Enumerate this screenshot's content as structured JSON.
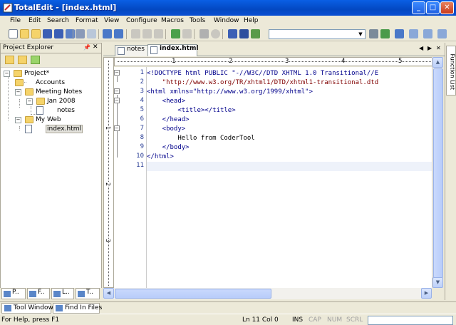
{
  "window": {
    "title": "TotalEdit - [index.html]"
  },
  "menu": [
    "File",
    "Edit",
    "Search",
    "Format",
    "View",
    "Configure",
    "Macros",
    "Tools",
    "Window",
    "Help"
  ],
  "explorer": {
    "title": "Project Explorer",
    "tree": {
      "project": "Project*",
      "accounts": "Accounts",
      "meeting_notes": "Meeting Notes",
      "jan2008": "Jan 2008",
      "notes": "notes",
      "my_web": "My Web",
      "index": "index.html"
    },
    "bottom_tabs": [
      "P..",
      "F..",
      "L..",
      "T.."
    ]
  },
  "editor": {
    "tabs": [
      {
        "label": "notes",
        "active": false
      },
      {
        "label": "index.html",
        "active": true
      }
    ],
    "ruler_numbers": [
      "1",
      "2",
      "3",
      "4",
      "5"
    ],
    "vruler_numbers": [
      "1",
      "2",
      "3"
    ],
    "line_numbers": [
      "1",
      "2",
      "3",
      "4",
      "5",
      "6",
      "7",
      "8",
      "9",
      "10",
      "11"
    ],
    "lines": [
      "<!DOCTYPE html PUBLIC \"-//W3C//DTD XHTML 1.0 Transitional//E",
      "    \"http://www.w3.org/TR/xhtml1/DTD/xhtml1-transitional.dtd",
      "<html xmlns=\"http://www.w3.org/1999/xhtml\">",
      "    <head>",
      "        <title></title>",
      "    </head>",
      "    <body>",
      "        Hello from CoderTool",
      "    </body>",
      "</html>",
      ""
    ],
    "current_line": 11
  },
  "function_list": {
    "label": "Function List"
  },
  "tool_window": {
    "tabs": [
      "Tool Window",
      "Find In Files"
    ]
  },
  "status": {
    "help": "For Help, press F1",
    "position": "Ln 11 Col 0",
    "ins": "INS",
    "cap": "CAP",
    "num": "NUM",
    "scrl": "SCRL"
  }
}
